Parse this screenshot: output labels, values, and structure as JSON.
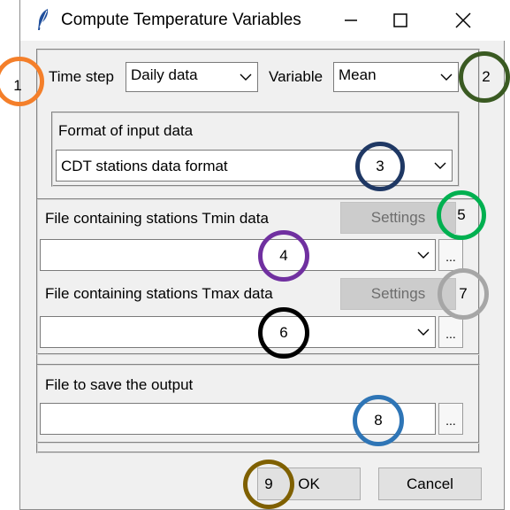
{
  "window": {
    "title": "Compute Temperature Variables"
  },
  "top_row": {
    "time_step_label": "Time step",
    "time_step_value": "Daily data",
    "variable_label": "Variable",
    "variable_value": "Mean"
  },
  "input_format": {
    "label": "Format of input data",
    "value": "CDT stations data format"
  },
  "tmin": {
    "label": "File containing stations Tmin data",
    "settings": "Settings",
    "value": "",
    "browse": "..."
  },
  "tmax": {
    "label": "File containing stations Tmax data",
    "settings": "Settings",
    "value": "",
    "browse": "..."
  },
  "output": {
    "label": "File to save the output",
    "value": "",
    "browse": "..."
  },
  "buttons": {
    "ok": "OK",
    "cancel": "Cancel"
  },
  "annotations": [
    {
      "label": "1",
      "color": "#f47f2a"
    },
    {
      "label": "2",
      "color": "#3a5a22"
    },
    {
      "label": "3",
      "color": "#1f3864"
    },
    {
      "label": "4",
      "color": "#7030a0"
    },
    {
      "label": "5",
      "color": "#00b050"
    },
    {
      "label": "6",
      "color": "#000000"
    },
    {
      "label": "7",
      "color": "#a6a6a6"
    },
    {
      "label": "8",
      "color": "#2e75b6"
    },
    {
      "label": "9",
      "color": "#7f6000"
    }
  ]
}
